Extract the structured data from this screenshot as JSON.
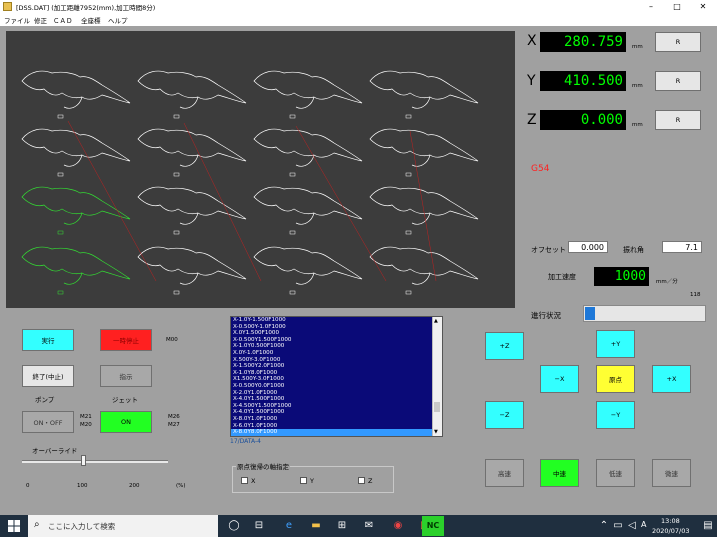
{
  "window": {
    "title": "[DSS.DAT] (加工距離7952(mm),加工時間8分)",
    "minimize": "–",
    "maximize": "□",
    "close": "✕"
  },
  "menu": [
    "ファイル",
    "修正",
    "ＣＡＤ",
    "全座標",
    "ヘルプ"
  ],
  "readout": {
    "x": {
      "label": "X",
      "value": "280.759",
      "unit": "mm",
      "reset": "R"
    },
    "y": {
      "label": "Y",
      "value": "410.500",
      "unit": "mm",
      "reset": "R"
    },
    "z": {
      "label": "Z",
      "value": "0.000",
      "unit": "mm",
      "reset": "R"
    }
  },
  "coord_system": "G54",
  "offset": {
    "label": "オフセット",
    "value": "0.000"
  },
  "angle": {
    "label": "振れ角",
    "value": "7.1"
  },
  "speed": {
    "label": "加工速度",
    "value": "1000",
    "unit": "mm／分"
  },
  "counter": "118",
  "progress": {
    "label": "進行状況",
    "fraction": 0.08
  },
  "controls": {
    "run": "実行",
    "pause": "一時停止",
    "m00": "M00",
    "stop": "終了(中止)",
    "skip": "指示",
    "pump_label": "ポンプ",
    "pump_btn": "ON・OFF",
    "m21": "M21",
    "m20": "M20",
    "jet_label": "ジェット",
    "jet_btn": "ON",
    "m26": "M26",
    "m27": "M27",
    "override_label": "オーバーライド",
    "ticks": [
      "0",
      "100",
      "200",
      "(%)"
    ],
    "override_value": 0.42
  },
  "code_lines": [
    "X-1.0Y-1.500F1000",
    "X-0.500Y-1.0F1000",
    "X.0Y1.500F1000",
    "X-0.500Y1.500F1000",
    "X-1.0Y0.500F1000",
    "X.0Y-1.0F1000",
    "X.500Y-3.0F1000",
    "X-1.500Y2.0F1000",
    "X-1.0Y8.0F1000",
    "X1.500Y-3.0F1000",
    "X-0.500Y0.0F1000",
    "X-2.0Y1.0F1000",
    "X-4.0Y1.500F1000",
    "X-4.500Y1.500F1000",
    "X-4.0Y1.500F1000",
    "X-8.0Y1.0F1000",
    "X-6.0Y1.0F1000",
    "X-8.0Y8.0F1000"
  ],
  "selected_line": 17,
  "code_status": "17/DATA-4",
  "origin_group": {
    "label": "原点復帰の軸指定",
    "axes": [
      "X",
      "Y",
      "Z"
    ]
  },
  "jog": {
    "zp": "+Z",
    "zm": "−Z",
    "yp": "+Y",
    "ym": "−Y",
    "xm": "−X",
    "xp": "+X",
    "origin": "原点"
  },
  "speed_buttons": {
    "high": "高速",
    "mid": "中速",
    "low": "低速",
    "fine": "微速"
  },
  "taskbar": {
    "search": "ここに入力して検索",
    "app": "NC",
    "lang": "A",
    "time": "13:08",
    "date": "2020/07/03"
  },
  "colors": {
    "lcd": "#00ff00",
    "canvas": "#3c3c3c",
    "codebg": "#0a0a78",
    "g54": "#ff2020"
  }
}
